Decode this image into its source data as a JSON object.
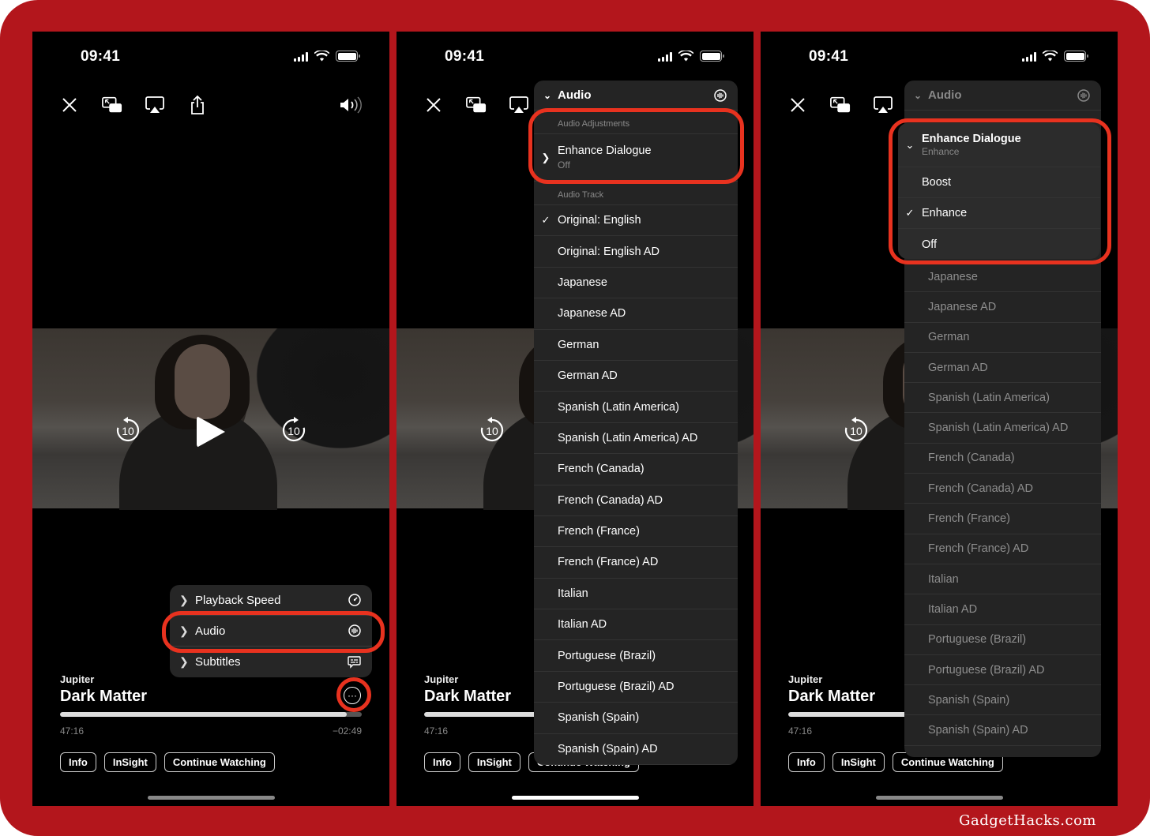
{
  "colors": {
    "frame": "#b3161c",
    "highlight_ring": "#e8321f",
    "menu_bg": "#242424"
  },
  "status_bar": {
    "time": "09:41"
  },
  "top_controls": [
    "close-icon",
    "picture-in-picture-icon",
    "airplay-icon",
    "share-icon"
  ],
  "volume_icon": "speaker-wave-icon",
  "player": {
    "show": "Jupiter",
    "title": "Dark Matter",
    "elapsed": "47:16",
    "remaining": "−02:49",
    "progress_percent": 95,
    "skip_back": "10",
    "skip_forward": "10",
    "buttons": [
      "Info",
      "InSight",
      "Continue Watching"
    ],
    "more_icon": "ellipsis-circle-icon"
  },
  "panel1_menu": [
    {
      "label": "Playback Speed",
      "icon": "gauge-icon"
    },
    {
      "label": "Audio",
      "icon": "waveform-circle-icon",
      "highlighted": true
    },
    {
      "label": "Subtitles",
      "icon": "caption-bubble-icon"
    }
  ],
  "panel2_menu": {
    "header": "Audio",
    "section_adjustments": "Audio Adjustments",
    "enhance_dialogue": {
      "label": "Enhance Dialogue",
      "value": "Off"
    },
    "section_track": "Audio Track",
    "tracks": [
      {
        "label": "Original: English",
        "selected": true
      },
      {
        "label": "Original: English AD"
      },
      {
        "label": "Japanese"
      },
      {
        "label": "Japanese AD"
      },
      {
        "label": "German"
      },
      {
        "label": "German AD"
      },
      {
        "label": "Spanish (Latin America)"
      },
      {
        "label": "Spanish (Latin America) AD"
      },
      {
        "label": "French (Canada)"
      },
      {
        "label": "French (Canada) AD"
      },
      {
        "label": "French (France)"
      },
      {
        "label": "French (France) AD"
      },
      {
        "label": "Italian"
      },
      {
        "label": "Italian AD"
      },
      {
        "label": "Portuguese (Brazil)"
      },
      {
        "label": "Portuguese (Brazil) AD"
      },
      {
        "label": "Spanish (Spain)"
      },
      {
        "label": "Spanish (Spain) AD"
      }
    ]
  },
  "panel3_menu": {
    "header": "Audio",
    "enhance_dialogue": {
      "label": "Enhance Dialogue",
      "value": "Enhance"
    },
    "options": [
      {
        "label": "Boost"
      },
      {
        "label": "Enhance",
        "selected": true
      },
      {
        "label": "Off"
      }
    ],
    "tracks": [
      "Japanese",
      "Japanese AD",
      "German",
      "German AD",
      "Spanish (Latin America)",
      "Spanish (Latin America) AD",
      "French (Canada)",
      "French (Canada) AD",
      "French (France)",
      "French (France) AD",
      "Italian",
      "Italian AD",
      "Portuguese (Brazil)",
      "Portuguese (Brazil) AD",
      "Spanish (Spain)",
      "Spanish (Spain) AD"
    ]
  },
  "watermark": "GadgetHacks.com"
}
